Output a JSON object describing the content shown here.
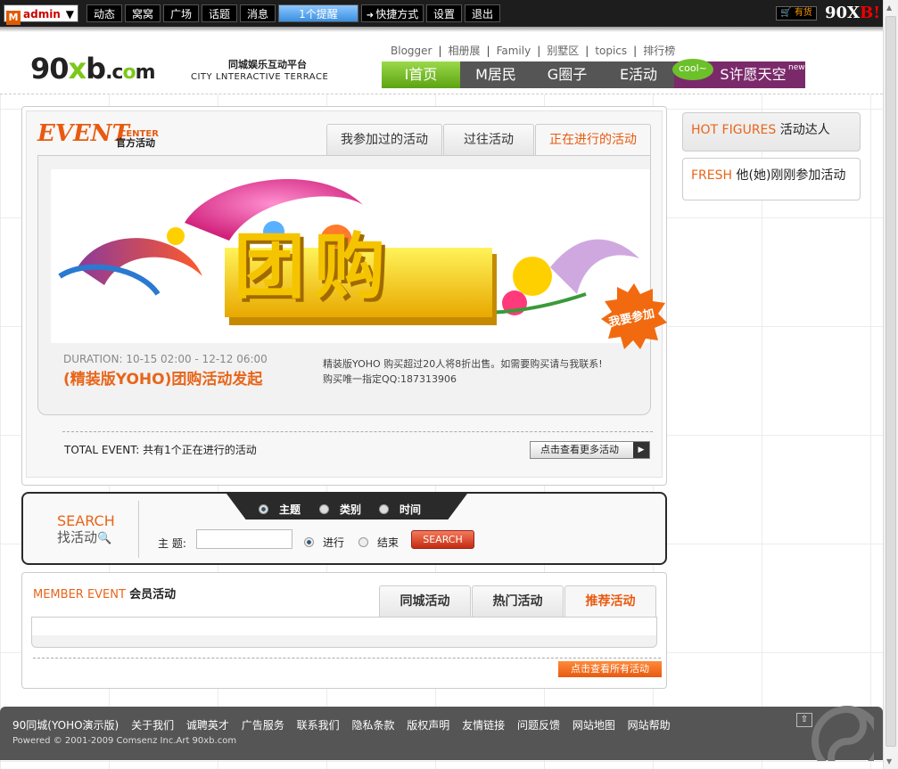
{
  "topbar": {
    "user": {
      "icon": "m-logo-icon",
      "name": "admin"
    },
    "items": [
      "动态",
      "窝窝",
      "广场",
      "话题",
      "消息"
    ],
    "reminder": "1个提醒",
    "shortcut": "快捷方式",
    "settings": "设置",
    "logout": "退出",
    "shop_badge": "有货",
    "brand": {
      "text": "90X",
      "accent": "B",
      "tail": "!"
    }
  },
  "header": {
    "logo": {
      "pre": "90",
      "x": "x",
      "mid": "b",
      "post": ".c",
      "dot": "o",
      "end": "m"
    },
    "slogan": "同城娱乐互动平台",
    "slogan_en": "CITY LNTERACTIVE TERRACE",
    "links": [
      "Blogger",
      "相册展",
      "Family",
      "别墅区",
      "topics",
      "排行榜"
    ],
    "nav": [
      {
        "label": "I首页"
      },
      {
        "label": "M居民"
      },
      {
        "label": "G圈子"
      },
      {
        "label": "E活动"
      },
      {
        "label": "S许愿天空"
      }
    ],
    "cool": "cool~",
    "new": "new"
  },
  "event_center": {
    "title": "EVENT",
    "title_small": "CENTER",
    "title_cn": "官方活动",
    "tabs": [
      "我参加过的活动",
      "过往活动",
      "正在进行的活动"
    ],
    "banner_text": "团购",
    "join_badge": "我要参加",
    "duration_label": "DURATION:",
    "duration": "10-15 02:00 - 12-12 06:00",
    "event_name": "(精装版YOHO)团购活动发起",
    "desc_line1": "精装版YOHO 购买超过20人将8折出售。如需要购买请与我联系!",
    "desc_line2": "购买唯一指定QQ:187313906",
    "total_label": "TOTAL EVENT:",
    "total_text": "共有1个正在进行的活动",
    "more_button": "点击查看更多活动"
  },
  "search": {
    "label": "SEARCH",
    "label_cn": "找活动",
    "tab_options": [
      "主题",
      "类别",
      "时间"
    ],
    "subject_label": "主 题:",
    "subject_value": "",
    "status_options": [
      "进行",
      "结束"
    ],
    "button": "SEARCH"
  },
  "member_event": {
    "title": "MEMBER EVENT",
    "title_cn": "会员活动",
    "tabs": [
      "同城活动",
      "热门活动",
      "推荐活动"
    ],
    "all_button": "点击查看所有活动"
  },
  "sidebar": {
    "hot_en": "HOT FIGURES",
    "hot_cn": "活动达人",
    "fresh_en": "FRESH",
    "fresh_cn": "他(她)刚刚参加活动"
  },
  "footer": {
    "links": [
      "90同城(YOHO演示版)",
      "关于我们",
      "诚聘英才",
      "广告服务",
      "联系我们",
      "隐私条款",
      "版权声明",
      "友情链接",
      "问题反馈",
      "网站地图",
      "网站帮助"
    ],
    "powered": "Powered © 2001-2009 Comsenz Inc.Art 90xb.com"
  },
  "colors": {
    "accent": "#e85a10",
    "nav_green": "#7cc81a",
    "dark": "#2a2a2a"
  }
}
